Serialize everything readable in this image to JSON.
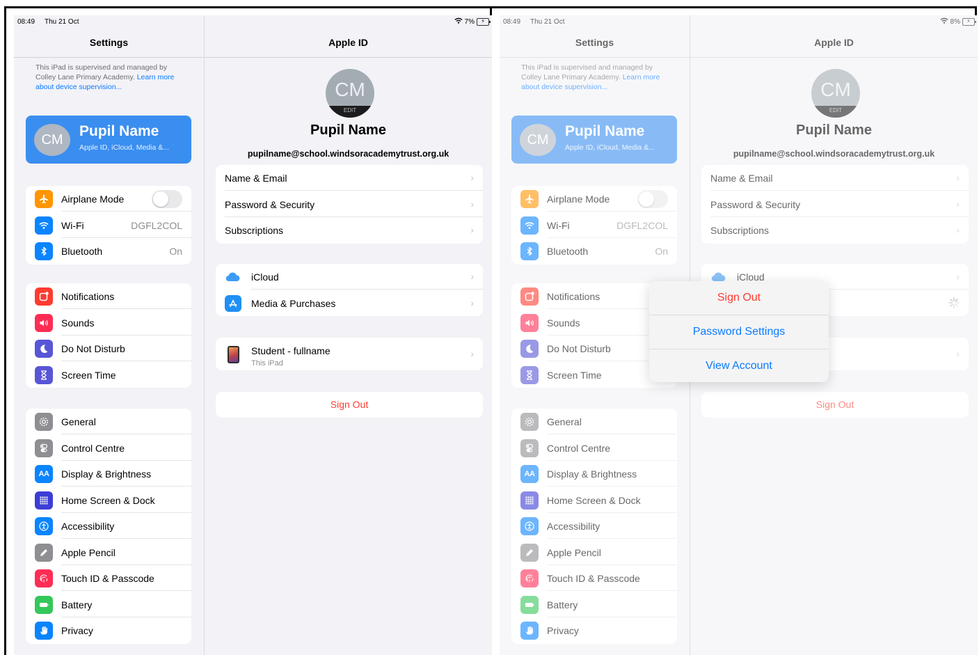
{
  "screens": [
    {
      "id": "left",
      "status": {
        "time": "08:49",
        "date": "Thu 21 Oct",
        "battery": "7%"
      },
      "popover_open": false
    },
    {
      "id": "right",
      "status": {
        "time": "08:49",
        "date": "Thu 21 Oct",
        "battery": "8%"
      },
      "popover_open": true
    }
  ],
  "sidebar": {
    "title": "Settings",
    "supervision_text": "This iPad is supervised and managed by Colley Lane Primary Academy.",
    "supervision_link": "Learn more about device supervision...",
    "profile": {
      "initials": "CM",
      "name": "Pupil Name",
      "subtitle": "Apple ID, iCloud, Media &..."
    },
    "groups": [
      [
        {
          "label": "Airplane Mode",
          "icon": "airplane-icon",
          "color": "#ff9500",
          "control": "toggle",
          "on": false
        },
        {
          "label": "Wi-Fi",
          "icon": "wifi-icon",
          "color": "#0a84ff",
          "value": "DGFL2COL"
        },
        {
          "label": "Bluetooth",
          "icon": "bluetooth-icon",
          "color": "#0a84ff",
          "value": "On"
        }
      ],
      [
        {
          "label": "Notifications",
          "icon": "notifications-icon",
          "color": "#ff3b30"
        },
        {
          "label": "Sounds",
          "icon": "speaker-icon",
          "color": "#ff2d55"
        },
        {
          "label": "Do Not Disturb",
          "icon": "moon-icon",
          "color": "#5856d6"
        },
        {
          "label": "Screen Time",
          "icon": "hourglass-icon",
          "color": "#5856d6"
        }
      ],
      [
        {
          "label": "General",
          "icon": "gear-icon",
          "color": "#8e8e93"
        },
        {
          "label": "Control Centre",
          "icon": "switches-icon",
          "color": "#8e8e93"
        },
        {
          "label": "Display & Brightness",
          "icon": "display-icon",
          "color": "#0a84ff"
        },
        {
          "label": "Home Screen & Dock",
          "icon": "home-grid-icon",
          "color": "#3d3dd6"
        },
        {
          "label": "Accessibility",
          "icon": "accessibility-icon",
          "color": "#0a84ff"
        },
        {
          "label": "Apple Pencil",
          "icon": "pencil-icon",
          "color": "#8e8e93"
        },
        {
          "label": "Touch ID & Passcode",
          "icon": "fingerprint-icon",
          "color": "#ff2d55"
        },
        {
          "label": "Battery",
          "icon": "battery-icon",
          "color": "#34c759"
        },
        {
          "label": "Privacy",
          "icon": "hand-icon",
          "color": "#0a84ff"
        }
      ]
    ]
  },
  "detail": {
    "title": "Apple ID",
    "avatar_initials": "CM",
    "avatar_edit": "EDIT",
    "name": "Pupil Name",
    "email": "pupilname@school.windsoracademytrust.org.uk",
    "account_rows": [
      "Name & Email",
      "Password & Security",
      "Subscriptions"
    ],
    "service_rows": [
      {
        "label": "iCloud",
        "icon": "icloud-icon",
        "color": "#3e9bf5"
      },
      {
        "label": "Media & Purchases",
        "icon": "app-store-icon",
        "color": "#1f8ff5"
      }
    ],
    "device": {
      "name": "Student - fullname",
      "subtitle": "This iPad"
    },
    "sign_out": "Sign Out"
  },
  "popover": {
    "items": [
      {
        "label": "Sign Out",
        "style": "destructive"
      },
      {
        "label": "Password Settings",
        "style": "default"
      },
      {
        "label": "View Account",
        "style": "default"
      }
    ]
  },
  "colors": {
    "accent": "#0a7aff",
    "destructive": "#ff3b30",
    "profile_card": "#3a8ef0"
  }
}
